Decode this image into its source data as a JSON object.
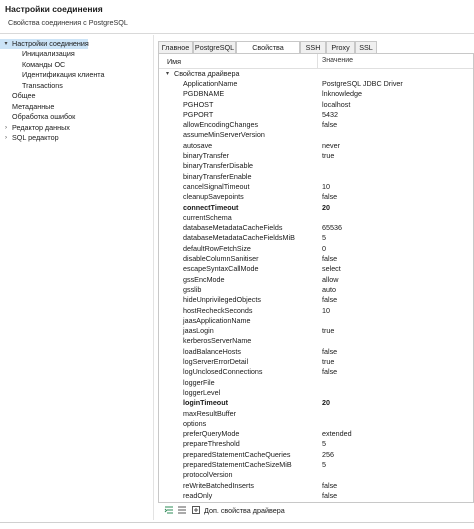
{
  "window": {
    "title": "Настройки соединения",
    "subtitle": "Свойства соединения с PostgreSQL"
  },
  "sidebar": {
    "items": [
      {
        "label": "Настройки соединения",
        "level": 0,
        "arrow": "▾",
        "selected": true
      },
      {
        "label": "Инициализация",
        "level": 1,
        "arrow": "",
        "selected": false
      },
      {
        "label": "Команды ОС",
        "level": 1,
        "arrow": "",
        "selected": false
      },
      {
        "label": "Идентификация клиента",
        "level": 1,
        "arrow": "",
        "selected": false
      },
      {
        "label": "Transactions",
        "level": 1,
        "arrow": "",
        "selected": false
      },
      {
        "label": "Общее",
        "level": 0,
        "arrow": "",
        "selected": false
      },
      {
        "label": "Метаданные",
        "level": 0,
        "arrow": "",
        "selected": false
      },
      {
        "label": "Обработка ошибок",
        "level": 0,
        "arrow": "",
        "selected": false
      },
      {
        "label": "Редактор данных",
        "level": 0,
        "arrow": "›",
        "selected": false
      },
      {
        "label": "SQL редактор",
        "level": 0,
        "arrow": "›",
        "selected": false
      }
    ]
  },
  "tabs": [
    {
      "label": "Главное",
      "active": false
    },
    {
      "label": "PostgreSQL",
      "active": false
    },
    {
      "label": "Свойства драйвера",
      "active": true
    },
    {
      "label": "SSH",
      "active": false
    },
    {
      "label": "Proxy",
      "active": false
    },
    {
      "label": "SSL",
      "active": false
    }
  ],
  "table": {
    "col_name": "Имя",
    "col_value": "Значение",
    "group_label": "Свойства драйвера",
    "rows": [
      {
        "k": "ApplicationName",
        "v": "PostgreSQL JDBC Driver",
        "bold": false
      },
      {
        "k": "PGDBNAME",
        "v": "lnknowledge",
        "bold": false
      },
      {
        "k": "PGHOST",
        "v": "localhost",
        "bold": false
      },
      {
        "k": "PGPORT",
        "v": "5432",
        "bold": false
      },
      {
        "k": "allowEncodingChanges",
        "v": "false",
        "bold": false
      },
      {
        "k": "assumeMinServerVersion",
        "v": "",
        "bold": false
      },
      {
        "k": "autosave",
        "v": "never",
        "bold": false
      },
      {
        "k": "binaryTransfer",
        "v": "true",
        "bold": false
      },
      {
        "k": "binaryTransferDisable",
        "v": "",
        "bold": false
      },
      {
        "k": "binaryTransferEnable",
        "v": "",
        "bold": false
      },
      {
        "k": "cancelSignalTimeout",
        "v": "10",
        "bold": false
      },
      {
        "k": "cleanupSavepoints",
        "v": "false",
        "bold": false
      },
      {
        "k": "connectTimeout",
        "v": "20",
        "bold": true
      },
      {
        "k": "currentSchema",
        "v": "",
        "bold": false
      },
      {
        "k": "databaseMetadataCacheFields",
        "v": "65536",
        "bold": false
      },
      {
        "k": "databaseMetadataCacheFieldsMiB",
        "v": "5",
        "bold": false
      },
      {
        "k": "defaultRowFetchSize",
        "v": "0",
        "bold": false
      },
      {
        "k": "disableColumnSanitiser",
        "v": "false",
        "bold": false
      },
      {
        "k": "escapeSyntaxCallMode",
        "v": "select",
        "bold": false
      },
      {
        "k": "gssEncMode",
        "v": "allow",
        "bold": false
      },
      {
        "k": "gsslib",
        "v": "auto",
        "bold": false
      },
      {
        "k": "hideUnprivilegedObjects",
        "v": "false",
        "bold": false
      },
      {
        "k": "hostRecheckSeconds",
        "v": "10",
        "bold": false
      },
      {
        "k": "jaasApplicationName",
        "v": "",
        "bold": false
      },
      {
        "k": "jaasLogin",
        "v": "true",
        "bold": false
      },
      {
        "k": "kerberosServerName",
        "v": "",
        "bold": false
      },
      {
        "k": "loadBalanceHosts",
        "v": "false",
        "bold": false
      },
      {
        "k": "logServerErrorDetail",
        "v": "true",
        "bold": false
      },
      {
        "k": "logUnclosedConnections",
        "v": "false",
        "bold": false
      },
      {
        "k": "loggerFile",
        "v": "",
        "bold": false
      },
      {
        "k": "loggerLevel",
        "v": "",
        "bold": false
      },
      {
        "k": "loginTimeout",
        "v": "20",
        "bold": true
      },
      {
        "k": "maxResultBuffer",
        "v": "",
        "bold": false
      },
      {
        "k": "options",
        "v": "",
        "bold": false
      },
      {
        "k": "preferQueryMode",
        "v": "extended",
        "bold": false
      },
      {
        "k": "prepareThreshold",
        "v": "5",
        "bold": false
      },
      {
        "k": "preparedStatementCacheQueries",
        "v": "256",
        "bold": false
      },
      {
        "k": "preparedStatementCacheSizeMiB",
        "v": "5",
        "bold": false
      },
      {
        "k": "protocolVersion",
        "v": "",
        "bold": false
      },
      {
        "k": "reWriteBatchedInserts",
        "v": "false",
        "bold": false
      },
      {
        "k": "readOnly",
        "v": "false",
        "bold": false
      }
    ]
  },
  "footer": {
    "add_property_label": "Доп. свойства драйвера"
  },
  "icons": {
    "expand": "expand-all-icon",
    "collapse": "collapse-all-icon",
    "add": "add-property-icon"
  },
  "colors": {
    "selection": "#cce4f7",
    "icon_accent": "#2e8b57"
  }
}
